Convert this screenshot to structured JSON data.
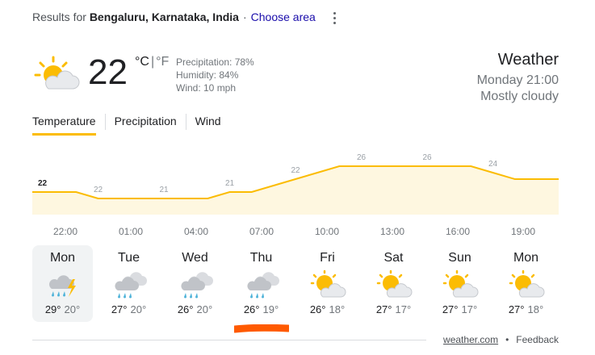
{
  "header": {
    "results_prefix": "Results for",
    "location": "Bengaluru, Karnataka, India",
    "separator": "·",
    "choose_area": "Choose area"
  },
  "current": {
    "temp": "22",
    "unit_c": "°C",
    "unit_sep": "|",
    "unit_f": "°F",
    "precipitation": "Precipitation: 78%",
    "humidity": "Humidity: 84%",
    "wind": "Wind: 10 mph",
    "icon": "partly-cloudy-icon"
  },
  "summary": {
    "title": "Weather",
    "datetime": "Monday 21:00",
    "condition": "Mostly cloudy"
  },
  "tabs": [
    {
      "label": "Temperature",
      "active": true
    },
    {
      "label": "Precipitation",
      "active": false
    },
    {
      "label": "Wind",
      "active": false
    }
  ],
  "hourly": {
    "temps": [
      22,
      22,
      22,
      21,
      21,
      21,
      21,
      21,
      21,
      22,
      22,
      23,
      24,
      25,
      26,
      26,
      26,
      26,
      26,
      26,
      26,
      25,
      24,
      24,
      24
    ],
    "labels": [
      "22",
      "22",
      "21",
      "21",
      "22",
      "26",
      "26",
      "24"
    ],
    "times": [
      "22:00",
      "01:00",
      "04:00",
      "07:00",
      "10:00",
      "13:00",
      "16:00",
      "19:00"
    ],
    "line_color": "#fbbc04",
    "fill_color": "#fef7e0"
  },
  "days": [
    {
      "name": "Mon",
      "hi": "29°",
      "lo": "20°",
      "icon": "thunderstorm-rain-icon",
      "active": true
    },
    {
      "name": "Tue",
      "hi": "27°",
      "lo": "20°",
      "icon": "rain-cloud-icon",
      "active": false
    },
    {
      "name": "Wed",
      "hi": "26°",
      "lo": "20°",
      "icon": "rain-cloud-icon",
      "active": false
    },
    {
      "name": "Thu",
      "hi": "26°",
      "lo": "19°",
      "icon": "rain-cloud-icon",
      "active": false
    },
    {
      "name": "Fri",
      "hi": "26°",
      "lo": "18°",
      "icon": "partly-cloudy-icon",
      "active": false
    },
    {
      "name": "Sat",
      "hi": "27°",
      "lo": "17°",
      "icon": "partly-cloudy-icon",
      "active": false
    },
    {
      "name": "Sun",
      "hi": "27°",
      "lo": "17°",
      "icon": "partly-cloudy-icon",
      "active": false
    },
    {
      "name": "Mon",
      "hi": "27°",
      "lo": "18°",
      "icon": "partly-cloudy-icon",
      "active": false
    }
  ],
  "footer": {
    "source": "weather.com",
    "bullet": "•",
    "feedback": "Feedback"
  },
  "colors": {
    "accent": "#fbbc04",
    "link": "#1a0dab",
    "annotation_mark": "#ff5a00"
  }
}
